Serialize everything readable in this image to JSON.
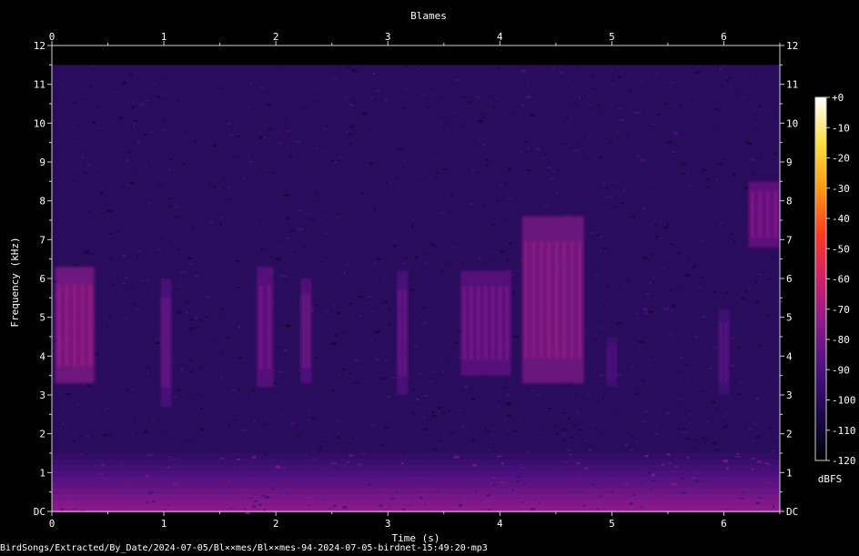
{
  "chart_data": {
    "type": "heatmap",
    "title": "Blames",
    "xlabel": "Time (s)",
    "ylabel": "Frequency (kHz)",
    "xlim": [
      0,
      6.5
    ],
    "ylim": [
      0,
      12
    ],
    "x_ticks": [
      0,
      1,
      2,
      3,
      4,
      5,
      6
    ],
    "y_ticks": [
      "DC",
      "1",
      "2",
      "3",
      "4",
      "5",
      "6",
      "7",
      "8",
      "9",
      "10",
      "11",
      "12"
    ],
    "colorbar": {
      "label": "dBFS",
      "range": [
        -120,
        0
      ],
      "ticks": [
        0,
        -10,
        -20,
        -30,
        -40,
        -50,
        -60,
        -70,
        -80,
        -90,
        -100,
        -110,
        -120
      ],
      "colors": [
        "#000000",
        "#1a0a4a",
        "#4a1080",
        "#8a1a8a",
        "#d0206a",
        "#ff3a20",
        "#ff9a10",
        "#ffe040",
        "#ffffff"
      ]
    },
    "background_level_dbfs": -100,
    "noise_floor_band": {
      "freq_khz": [
        0,
        1.5
      ],
      "level_dbfs": -75
    },
    "signal_ceiling_khz": 11.5,
    "events": [
      {
        "t_start": 0.03,
        "t_end": 0.38,
        "f_low": 3.3,
        "f_high": 6.3,
        "level_dbfs": -70
      },
      {
        "t_start": 0.97,
        "t_end": 1.07,
        "f_low": 2.7,
        "f_high": 6.0,
        "level_dbfs": -82
      },
      {
        "t_start": 1.83,
        "t_end": 1.98,
        "f_low": 3.2,
        "f_high": 6.3,
        "level_dbfs": -78
      },
      {
        "t_start": 2.22,
        "t_end": 2.32,
        "f_low": 3.3,
        "f_high": 6.0,
        "level_dbfs": -80
      },
      {
        "t_start": 3.08,
        "t_end": 3.18,
        "f_low": 3.0,
        "f_high": 6.2,
        "level_dbfs": -82
      },
      {
        "t_start": 3.65,
        "t_end": 4.1,
        "f_low": 3.5,
        "f_high": 6.2,
        "level_dbfs": -78
      },
      {
        "t_start": 4.2,
        "t_end": 4.75,
        "f_low": 3.3,
        "f_high": 7.6,
        "level_dbfs": -72
      },
      {
        "t_start": 4.95,
        "t_end": 5.05,
        "f_low": 3.2,
        "f_high": 4.5,
        "level_dbfs": -88
      },
      {
        "t_start": 5.95,
        "t_end": 6.05,
        "f_low": 3.0,
        "f_high": 5.2,
        "level_dbfs": -86
      },
      {
        "t_start": 6.22,
        "t_end": 6.5,
        "f_low": 6.8,
        "f_high": 8.5,
        "level_dbfs": -75
      }
    ]
  },
  "file_path": "BirdSongs/Extracted/By_Date/2024-07-05/Bl××mes/Bl××mes-94-2024-07-05-birdnet-15:49:20·mp3"
}
